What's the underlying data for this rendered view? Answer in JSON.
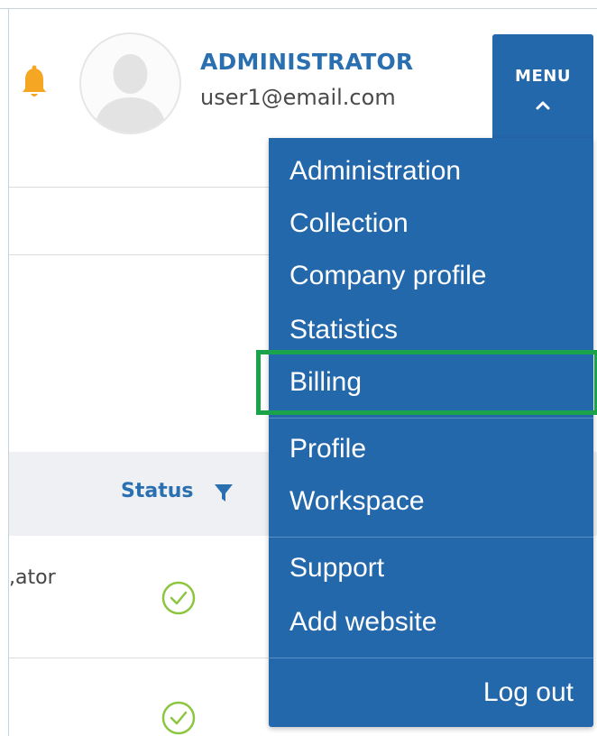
{
  "header": {
    "user_name": "ADMINISTRATOR",
    "user_email": "user1@email.com",
    "notification_icon": "bell-icon",
    "avatar_icon": "user-silhouette-icon",
    "menu_label": "MENU",
    "menu_chevron_icon": "chevron-up-icon"
  },
  "table": {
    "status_header": "Status",
    "filter_icon": "filter-icon",
    "rows": [
      {
        "text": "ator,",
        "status_icon": "check-circle-icon"
      },
      {
        "text": "",
        "status_icon": "check-circle-icon"
      }
    ]
  },
  "menu": {
    "groups": [
      {
        "items": [
          "Administration",
          "Collection",
          "Company profile",
          "Statistics",
          "Billing"
        ]
      },
      {
        "items": [
          "Profile",
          "Workspace"
        ]
      },
      {
        "items": [
          "Support",
          "Add website"
        ]
      }
    ],
    "logout_label": "Log out",
    "highlighted_item": "Billing"
  },
  "colors": {
    "menu_background": "#2468ac",
    "brand_text": "#2a6fb0",
    "bell": "#f5a623",
    "highlight": "#1aa34a",
    "check": "#8cc63f"
  }
}
